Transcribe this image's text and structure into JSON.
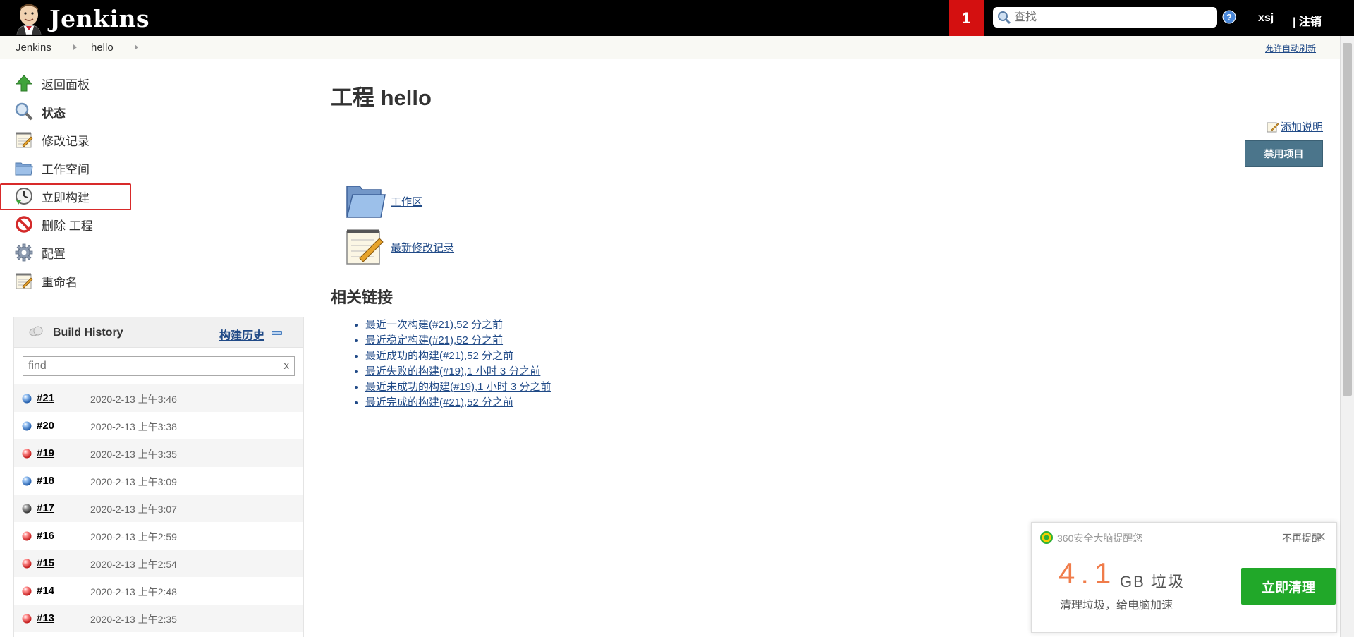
{
  "header": {
    "app_title": "Jenkins",
    "notification_count": "1",
    "search_placeholder": "查找",
    "user": "xsj",
    "logout": "| 注销"
  },
  "breadcrumb": {
    "items": [
      "Jenkins",
      "hello"
    ],
    "auto_refresh": "允许自动刷新"
  },
  "sidebar": {
    "tasks": [
      {
        "label": "返回面板",
        "icon": "up-arrow-icon"
      },
      {
        "label": "状态",
        "icon": "search-icon"
      },
      {
        "label": "修改记录",
        "icon": "notepad-icon"
      },
      {
        "label": "工作空间",
        "icon": "folder-icon"
      },
      {
        "label": "立即构建",
        "icon": "clock-icon"
      },
      {
        "label": "删除 工程",
        "icon": "no-entry-icon"
      },
      {
        "label": "配置",
        "icon": "gear-icon"
      },
      {
        "label": "重命名",
        "icon": "notepad-icon"
      }
    ]
  },
  "build_history": {
    "title": "Build History",
    "trend": "构建历史",
    "filter_placeholder": "find",
    "clear": "x",
    "builds": [
      {
        "num": "#21",
        "date": "2020-2-13 上午3:46",
        "status": "blue"
      },
      {
        "num": "#20",
        "date": "2020-2-13 上午3:38",
        "status": "blue"
      },
      {
        "num": "#19",
        "date": "2020-2-13 上午3:35",
        "status": "red"
      },
      {
        "num": "#18",
        "date": "2020-2-13 上午3:09",
        "status": "blue"
      },
      {
        "num": "#17",
        "date": "2020-2-13 上午3:07",
        "status": "grey"
      },
      {
        "num": "#16",
        "date": "2020-2-13 上午2:59",
        "status": "red"
      },
      {
        "num": "#15",
        "date": "2020-2-13 上午2:54",
        "status": "red"
      },
      {
        "num": "#14",
        "date": "2020-2-13 上午2:48",
        "status": "red"
      },
      {
        "num": "#13",
        "date": "2020-2-13 上午2:35",
        "status": "red"
      }
    ]
  },
  "main": {
    "title": "工程 hello",
    "add_description": "添加说明",
    "disable_button": "禁用项目",
    "workspace_link": "工作区",
    "changes_link": "最新修改记录",
    "related_title": "相关链接",
    "related_links": [
      "最近一次构建(#21),52 分之前",
      "最近稳定构建(#21),52 分之前",
      "最近成功的构建(#21),52 分之前",
      "最近失败的构建(#19),1 小时 3 分之前",
      "最近未成功的构建(#19),1 小时 3 分之前",
      "最近完成的构建(#21),52 分之前"
    ]
  },
  "popup": {
    "title": "360安全大脑提醒您",
    "dismiss": "不再提醒",
    "close": "✕",
    "amount": "4.1",
    "unit": "GB 垃圾",
    "subtitle": "清理垃圾，给电脑加速",
    "button": "立即清理"
  },
  "colors": {
    "header_bg": "#000000",
    "notification_bg": "#d41010",
    "link": "#204a87",
    "disable_button_bg": "#4b758b",
    "popup_button_bg": "#21a829",
    "popup_amount": "#f07c4a"
  }
}
